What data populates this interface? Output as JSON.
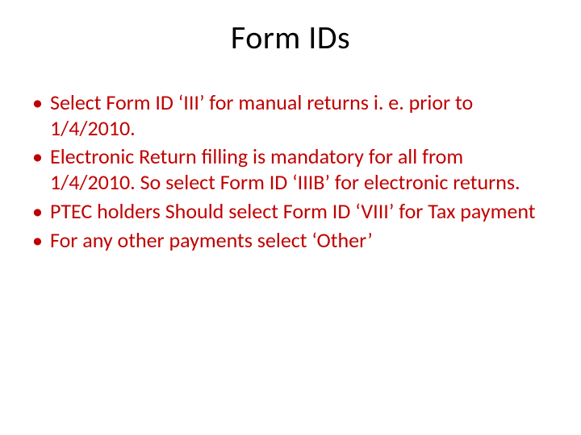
{
  "slide": {
    "title": "Form IDs",
    "bullets": [
      "Select Form ID ‘III’ for manual returns i. e. prior to 1/4/2010.",
      "Electronic Return filling is mandatory for all from 1/4/2010.  So select Form ID ‘IIIB’ for electronic returns.",
      "PTEC holders Should select Form ID ‘VIII’ for Tax payment",
      "For any other payments select ‘Other’"
    ]
  }
}
